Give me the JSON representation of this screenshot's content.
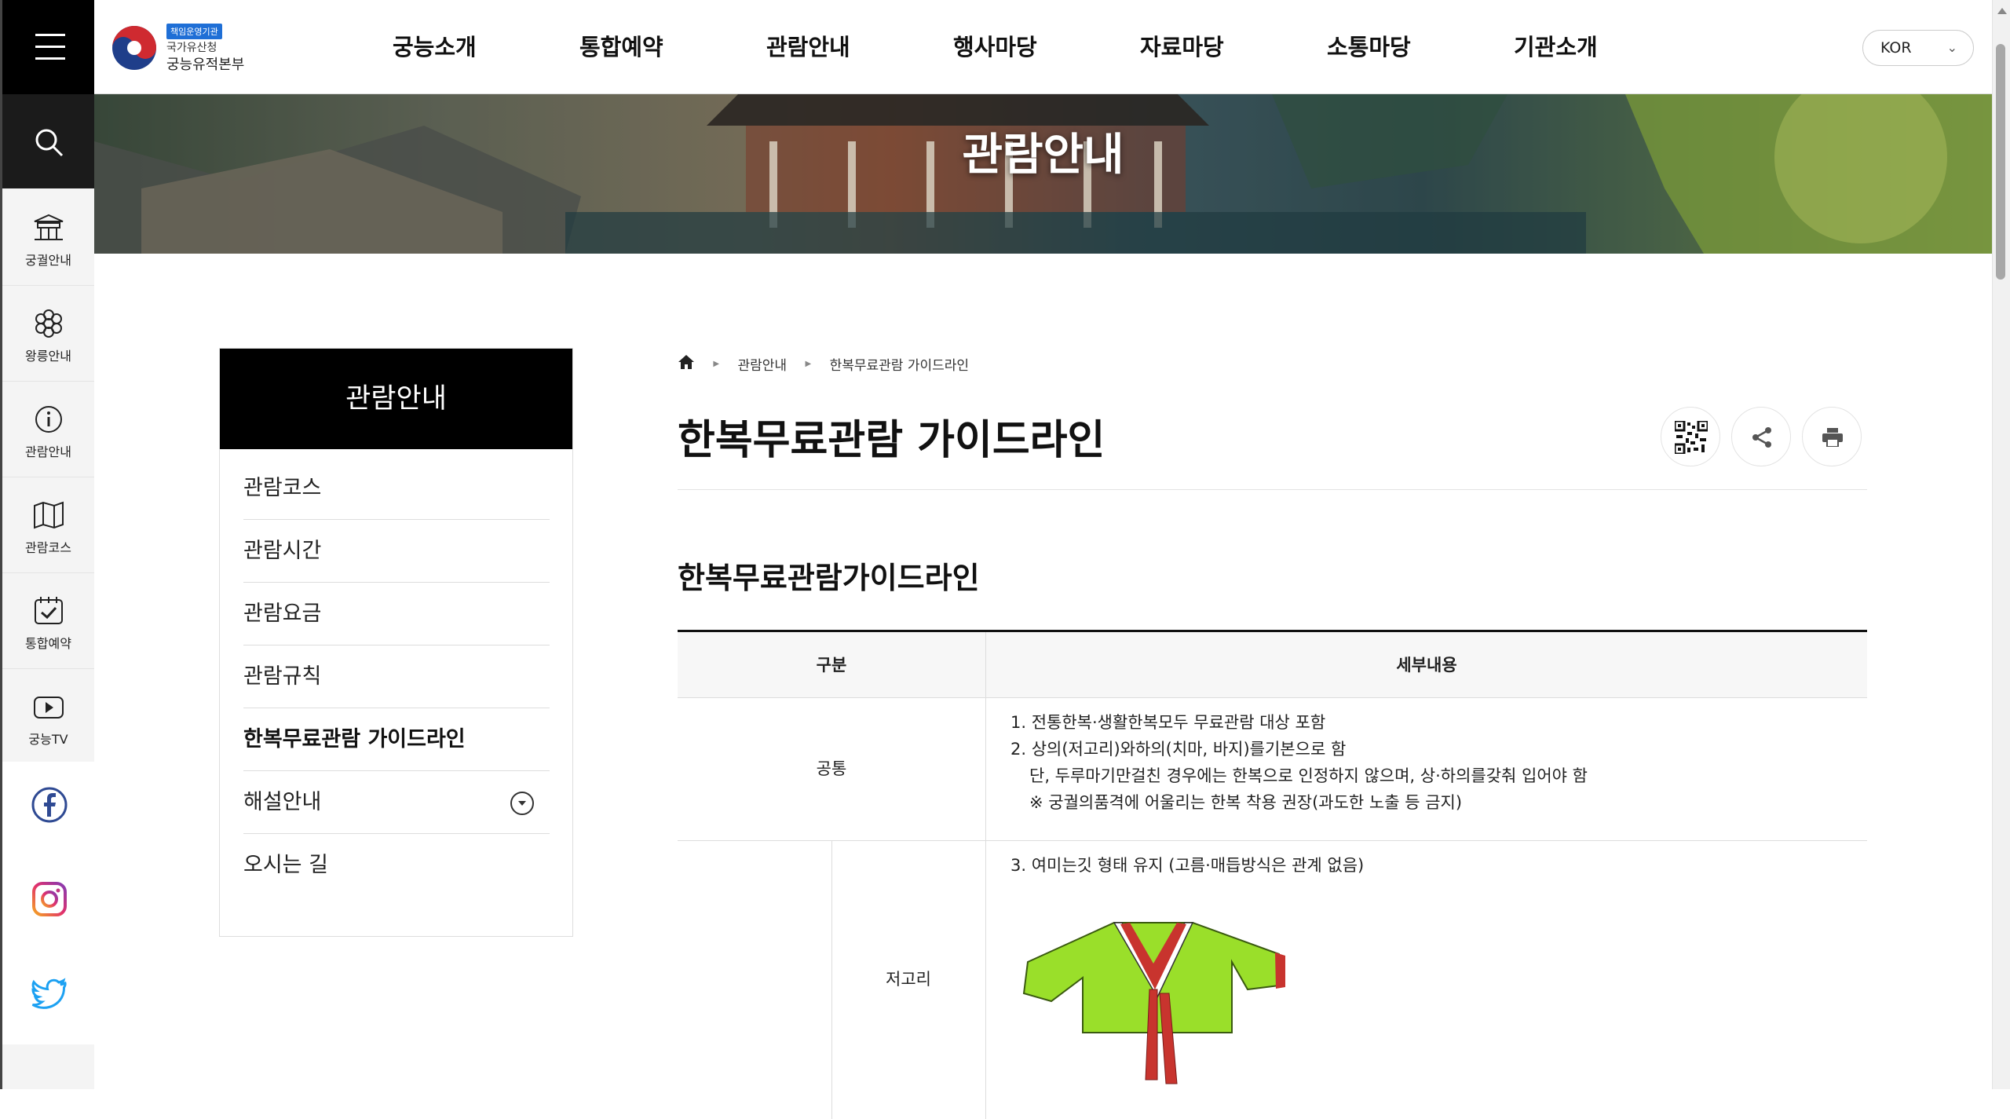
{
  "header": {
    "logo": {
      "badge": "책임운영기관",
      "line1": "국가유산청",
      "line2": "궁능유적본부"
    },
    "nav": [
      "궁능소개",
      "통합예약",
      "관람안내",
      "행사마당",
      "자료마당",
      "소통마당",
      "기관소개"
    ],
    "language": "KOR"
  },
  "sidebar": {
    "items": [
      {
        "label": "궁궐안내",
        "icon": "palace-icon"
      },
      {
        "label": "왕릉안내",
        "icon": "royal-tomb-icon"
      },
      {
        "label": "관람안내",
        "icon": "info-icon"
      },
      {
        "label": "관람코스",
        "icon": "map-icon"
      },
      {
        "label": "통합예약",
        "icon": "calendar-check-icon"
      },
      {
        "label": "궁능TV",
        "icon": "play-icon"
      }
    ],
    "social": [
      "facebook-icon",
      "instagram-icon",
      "twitter-icon"
    ]
  },
  "banner": {
    "title": "관람안내"
  },
  "lnb": {
    "title": "관람안내",
    "items": [
      {
        "label": "관람코스"
      },
      {
        "label": "관람시간"
      },
      {
        "label": "관람요금"
      },
      {
        "label": "관람규칙"
      },
      {
        "label": "한복무료관람 가이드라인"
      },
      {
        "label": "해설안내"
      },
      {
        "label": "오시는 길"
      }
    ],
    "active_index": 4
  },
  "breadcrumb": {
    "items": [
      "관람안내",
      "한복무료관람 가이드라인"
    ]
  },
  "page": {
    "title": "한복무료관람 가이드라인",
    "section_title": "한복무료관람가이드라인"
  },
  "table": {
    "headers": [
      "구분",
      "세부내용"
    ],
    "rows": [
      {
        "category": "공통",
        "lines": [
          "1. 전통한복·생활한복모두 무료관람 대상 포함",
          "2. 상의(저고리)와하의(치마, 바지)를기본으로 함",
          "단, 두루마기만걸친 경우에는 한복으로 인정하지 않으며, 상·하의를갖춰 입어야 함",
          "※ 궁궐의품격에 어울리는 한복 착용 권장(과도한 노출 등 금지)"
        ]
      },
      {
        "category": "저고리",
        "lines": [
          "3. 여미는깃 형태 유지 (고름·매듭방식은 관계 없음)"
        ]
      }
    ]
  },
  "colors": {
    "accent_dark": "#000000",
    "jeogori_body": "#9adf2a",
    "jeogori_trim": "#c8342e",
    "logo_blue": "#1f6fd6"
  }
}
